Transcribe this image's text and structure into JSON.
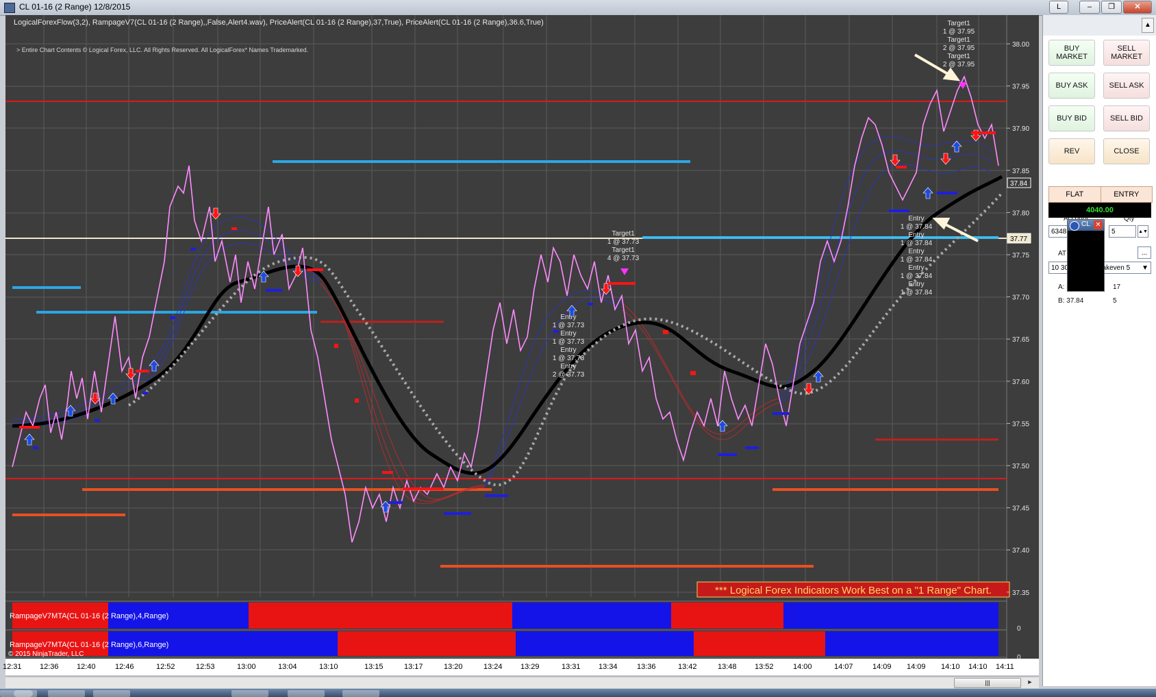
{
  "window": {
    "title": "CL 01-16 (2 Range)  12/8/2015",
    "btn_l": "L",
    "btn_min": "–",
    "btn_max": "❐",
    "btn_close": "✕"
  },
  "chart": {
    "indicators_line": "LogicalForexFlow(3,2),  RampageV7(CL 01-16 (2 Range),,False,Alert4.wav), PriceAlert(CL 01-16 (2 Range),37,True), PriceAlert(CL 01-16 (2 Range),36.6,True)",
    "copyright_line": "> Entire Chart Contents © Logical Forex, LLC. All Rights Reserved. All LogicalForex* Names Trademarked.",
    "banner": "*** Logical Forex Indicators Work Best on a \"1 Range\" Chart.",
    "price_ticks": [
      "38.00",
      "37.95",
      "37.90",
      "37.85",
      "37.80",
      "37.75",
      "37.70",
      "37.65",
      "37.60",
      "37.55",
      "37.50",
      "37.45",
      "37.40",
      "37.35"
    ],
    "current_price": "37.84",
    "alert_price": "37.77",
    "time_ticks": [
      "12:31",
      "12:36",
      "12:40",
      "12:46",
      "12:52",
      "12:53",
      "13:00",
      "13:04",
      "13:10",
      "13:15",
      "13:17",
      "13:20",
      "13:24",
      "13:29",
      "13:31",
      "13:34",
      "13:36",
      "13:42",
      "13:48",
      "13:52",
      "14:00",
      "14:07",
      "14:09",
      "14:09",
      "14:10",
      "14:10",
      "14:11"
    ],
    "sub1_label": "RampageV7MTA(CL 01-16 (2 Range),4,Range)",
    "sub2_label": "RampageV7MTA(CL 01-16 (2 Range),6,Range)",
    "sub_zero": "0",
    "ninja_copyright": "© 2015 NinjaTrader, LLC",
    "annot_target_mid": [
      "Target1",
      "1 @ 37.73",
      "Target1",
      "4 @ 37.73"
    ],
    "annot_entry_mid": [
      "Entry",
      "1 @ 37.73",
      "Entry",
      "1 @ 37.73",
      "Entry",
      "1 @ 37.73",
      "Entry",
      "2 @ 37.73"
    ],
    "annot_target_right": [
      "Target1",
      "1 @ 37.95",
      "Target1",
      "2 @ 37.95",
      "Target1",
      "2 @ 37.95"
    ],
    "annot_entry_right": [
      "Entry",
      "1 @ 37.84",
      "Entry",
      "1 @ 37.84",
      "Entry",
      "1 @ 37.84",
      "Entry",
      "1 @ 37.84",
      "Entry",
      "1 @ 37.84"
    ],
    "colors": {
      "bg": "#3d3d3d",
      "up": "#1e1ee0",
      "down": "#ff1010",
      "price": "#ff8cff"
    }
  },
  "panel": {
    "buy_market": "BUY MARKET",
    "sell_market": "SELL MARKET",
    "buy_ask": "BUY ASK",
    "sell_ask": "SELL ASK",
    "buy_bid": "BUY BID",
    "sell_bid": "SELL BID",
    "rev": "REV",
    "close": "CLOSE",
    "flat": "FLAT",
    "entry": "ENTRY",
    "pnl": "4040.00",
    "account_label": "Account",
    "qty_label": "Qty",
    "account_value": "6348",
    "qty_value": "5",
    "atm_label": "AT",
    "atm_value": "10 30",
    "atm_value_tail": "eakeven 5",
    "ellipsis": "...",
    "ask_label": "A: 37.85",
    "ask_size": "17",
    "bid_label": "B: 37.84",
    "bid_size": "5",
    "popup_title": "CL"
  },
  "scrollbar": {
    "thumb": "|||",
    "left": "◄",
    "right": "►"
  }
}
